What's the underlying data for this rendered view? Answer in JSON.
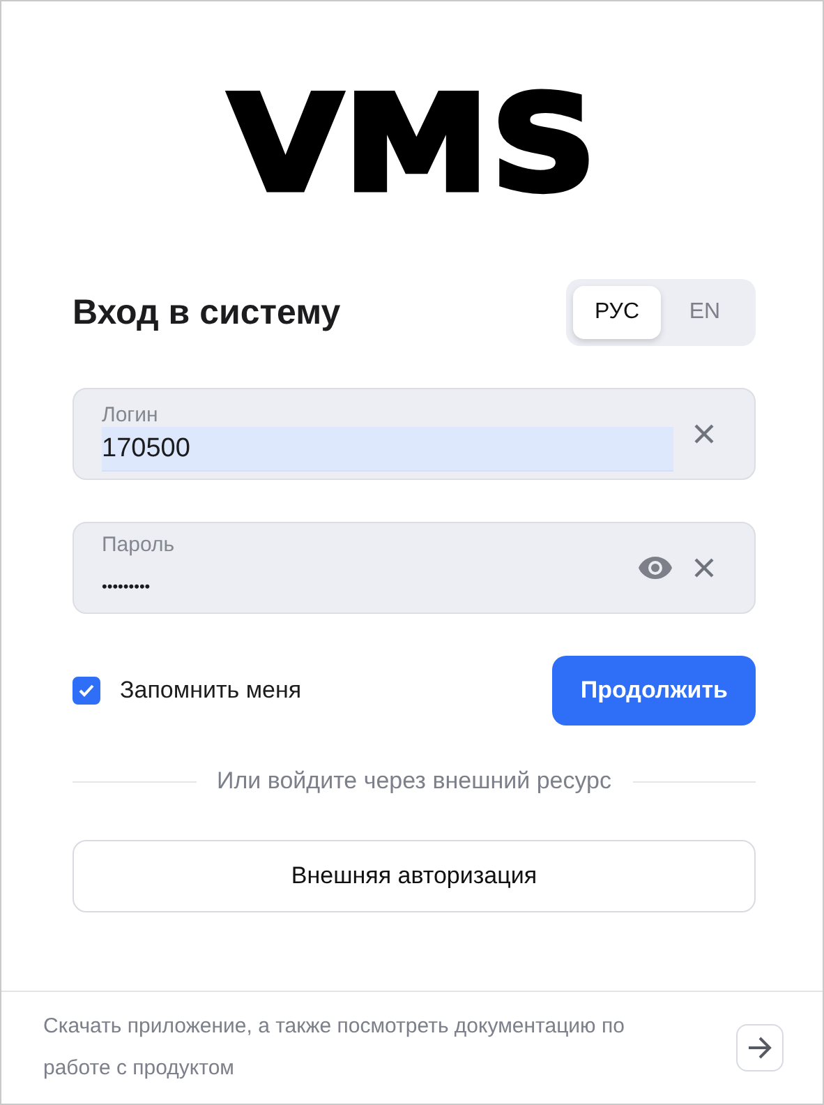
{
  "logo": "VMS",
  "title": "Вход в систему",
  "languages": [
    {
      "label": "РУС",
      "selected": true
    },
    {
      "label": "EN",
      "selected": false
    }
  ],
  "fields": [
    {
      "kind": "text",
      "label": "Логин",
      "value": "170500",
      "autofilled": true
    },
    {
      "kind": "password",
      "label": "Пароль",
      "value": "•••••••••",
      "autofilled": false
    }
  ],
  "remember": {
    "label": "Запомнить меня",
    "checked": true
  },
  "submit": "Продолжить",
  "divider_text": "Или войдите через внешний ресурс",
  "external_button": "Внешняя авторизация",
  "footer": {
    "text": "Скачать приложение, а также посмотреть документацию по работе с продуктом"
  }
}
